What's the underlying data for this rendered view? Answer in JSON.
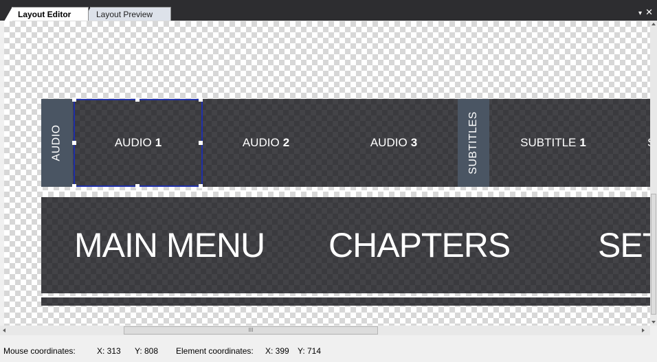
{
  "tabs": [
    {
      "label": "Layout Editor",
      "active": true
    },
    {
      "label": "Layout Preview",
      "active": false
    }
  ],
  "window_controls": {
    "dropdown": "▾",
    "close": "✕"
  },
  "audio_row": {
    "audio_side_label": "AUDIO",
    "subtitles_side_label": "SUBTITLES",
    "items": [
      {
        "text": "AUDIO",
        "num": "1",
        "selected": true
      },
      {
        "text": "AUDIO",
        "num": "2"
      },
      {
        "text": "AUDIO",
        "num": "3"
      },
      {
        "text": "SUBTITLE",
        "num": "1"
      },
      {
        "text": "S",
        "num": ""
      }
    ]
  },
  "menu_row": {
    "items": [
      "MAIN MENU",
      "CHAPTERS",
      "SET"
    ]
  },
  "scrollbar": {
    "grip": "III"
  },
  "status": {
    "mouse_label": "Mouse coordinates:",
    "mouse_x": "X: 313",
    "mouse_y": "Y: 808",
    "element_label": "Element coordinates:",
    "element_x": "X: 399",
    "element_y": "Y: 714"
  },
  "colors": {
    "selection_border": "#1f2fa8",
    "side_label_bg": "#4a5563",
    "dark_panel": "#3a3a3e",
    "tabstrip_bg": "#2d2d30"
  }
}
